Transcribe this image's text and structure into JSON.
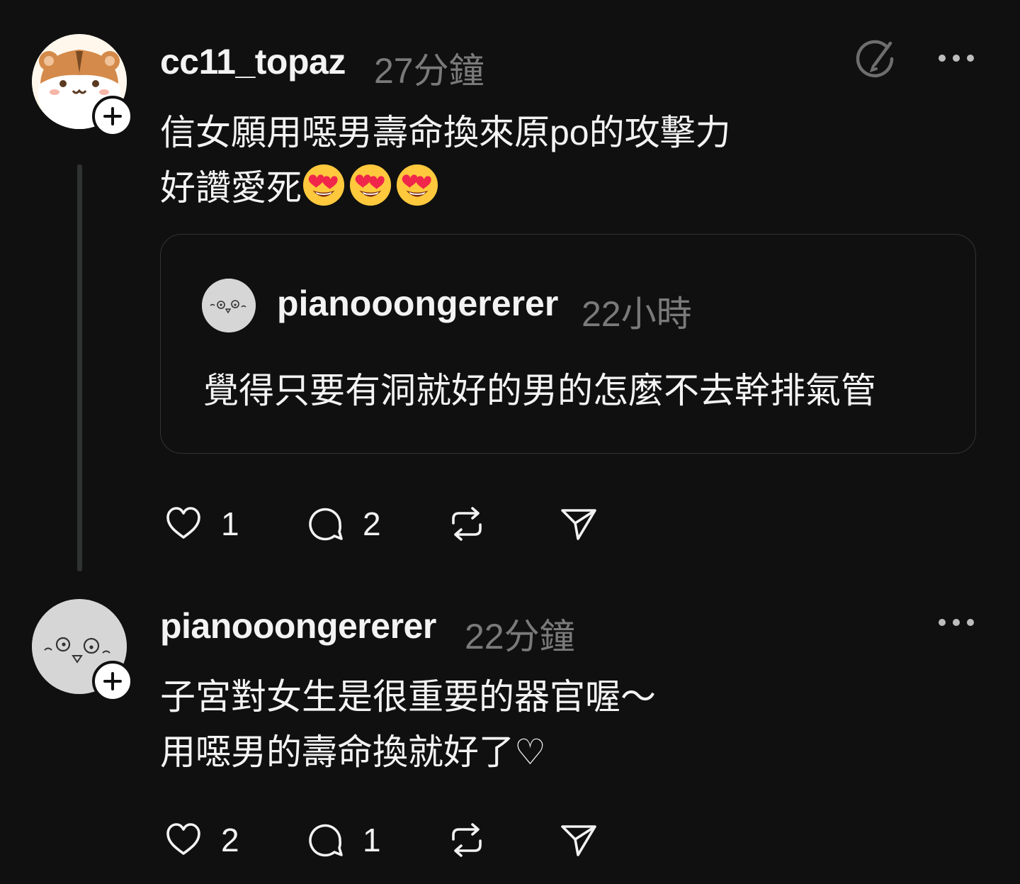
{
  "posts": [
    {
      "username": "cc11_topaz",
      "time": "27分鐘",
      "line1": "信女願用噁男壽命換來原po的攻擊力",
      "line2": "好讚愛死",
      "emoji": "heart-eyes-emoji",
      "quote": {
        "username": "pianooongererer",
        "time": "22小時",
        "text": "覺得只要有洞就好的男的怎麼不去幹排氣管"
      },
      "likes": "1",
      "replies": "2"
    },
    {
      "username": "pianooongererer",
      "time": "22分鐘",
      "line1": "子宮對女生是很重要的器官喔～",
      "line2": "用噁男的壽命換就好了♡",
      "likes": "2",
      "replies": "1"
    }
  ],
  "icons": {
    "follow": "plus-icon",
    "edit": "edit-icon",
    "more": "more-icon",
    "like": "heart-icon",
    "reply": "comment-icon",
    "repost": "repost-icon",
    "share": "send-icon"
  },
  "colors": {
    "background": "#101010",
    "text": "#f3f3f3",
    "muted": "#7a7a7a"
  }
}
